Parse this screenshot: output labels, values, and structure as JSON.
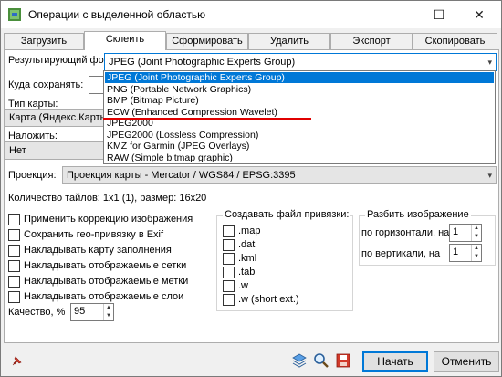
{
  "window": {
    "title": "Операции с выделенной областью",
    "controls": {
      "minimize": "—",
      "maximize": "☐",
      "close": "✕"
    }
  },
  "tabs": [
    {
      "label": "Загрузить",
      "active": false
    },
    {
      "label": "Склеить",
      "active": true
    },
    {
      "label": "Сформировать",
      "active": false
    },
    {
      "label": "Удалить",
      "active": false
    },
    {
      "label": "Экспорт",
      "active": false
    },
    {
      "label": "Скопировать",
      "active": false
    }
  ],
  "form": {
    "format_label": "Результирующий формат:",
    "format_value": "JPEG (Joint Photographic Experts Group)",
    "save_label": "Куда сохранять:",
    "save_value": "",
    "maptype_label": "Тип карты:",
    "maptype_value": "Карта (Яндекс.Карты)",
    "overlay_label": "Наложить:",
    "overlay_value": "Нет",
    "projection_label": "Проекция:",
    "projection_value": "Проекция карты - Mercator / WGS84 / EPSG:3395",
    "tiles_info": "Количество тайлов: 1x1 (1), размер: 16x20"
  },
  "dropdown_options": [
    {
      "label": "JPEG (Joint Photographic Experts Group)",
      "selected": true
    },
    {
      "label": "PNG (Portable Network Graphics)",
      "selected": false
    },
    {
      "label": "BMP (Bitmap Picture)",
      "selected": false
    },
    {
      "label": "ECW (Enhanced Compression Wavelet)",
      "selected": false
    },
    {
      "label": "JPEG2000",
      "selected": false
    },
    {
      "label": "JPEG2000 (Lossless Compression)",
      "selected": false
    },
    {
      "label": "KMZ for Garmin (JPEG Overlays)",
      "selected": false
    },
    {
      "label": "RAW (Simple bitmap graphic)",
      "selected": false
    }
  ],
  "annotation_color": "#e00000",
  "options": [
    {
      "label": "Применить коррекцию изображения",
      "checked": false
    },
    {
      "label": "Сохранить гео-привязку в Exif",
      "checked": false
    },
    {
      "label": "Накладывать карту заполнения",
      "checked": false
    },
    {
      "label": "Накладывать отображаемые сетки",
      "checked": false
    },
    {
      "label": "Накладывать отображаемые метки",
      "checked": false
    },
    {
      "label": "Накладывать отображаемые слои",
      "checked": false
    }
  ],
  "quality": {
    "label": "Качество, %",
    "value": "95"
  },
  "georef": {
    "title": "Создавать файл привязки:",
    "items": [
      {
        "label": ".map",
        "checked": false
      },
      {
        "label": ".dat",
        "checked": false
      },
      {
        "label": ".kml",
        "checked": false
      },
      {
        "label": ".tab",
        "checked": false
      },
      {
        "label": ".w",
        "checked": false
      },
      {
        "label": ".w (short ext.)",
        "checked": false
      }
    ]
  },
  "split": {
    "title": "Разбить изображение",
    "horizontal_label": "по горизонтали, на",
    "horizontal_value": "1",
    "vertical_label": "по вертикали, на",
    "vertical_value": "1"
  },
  "buttons": {
    "start": "Начать",
    "cancel": "Отменить"
  },
  "icons": [
    "pin-icon",
    "layers-icon",
    "zoom-icon",
    "save-icon"
  ]
}
